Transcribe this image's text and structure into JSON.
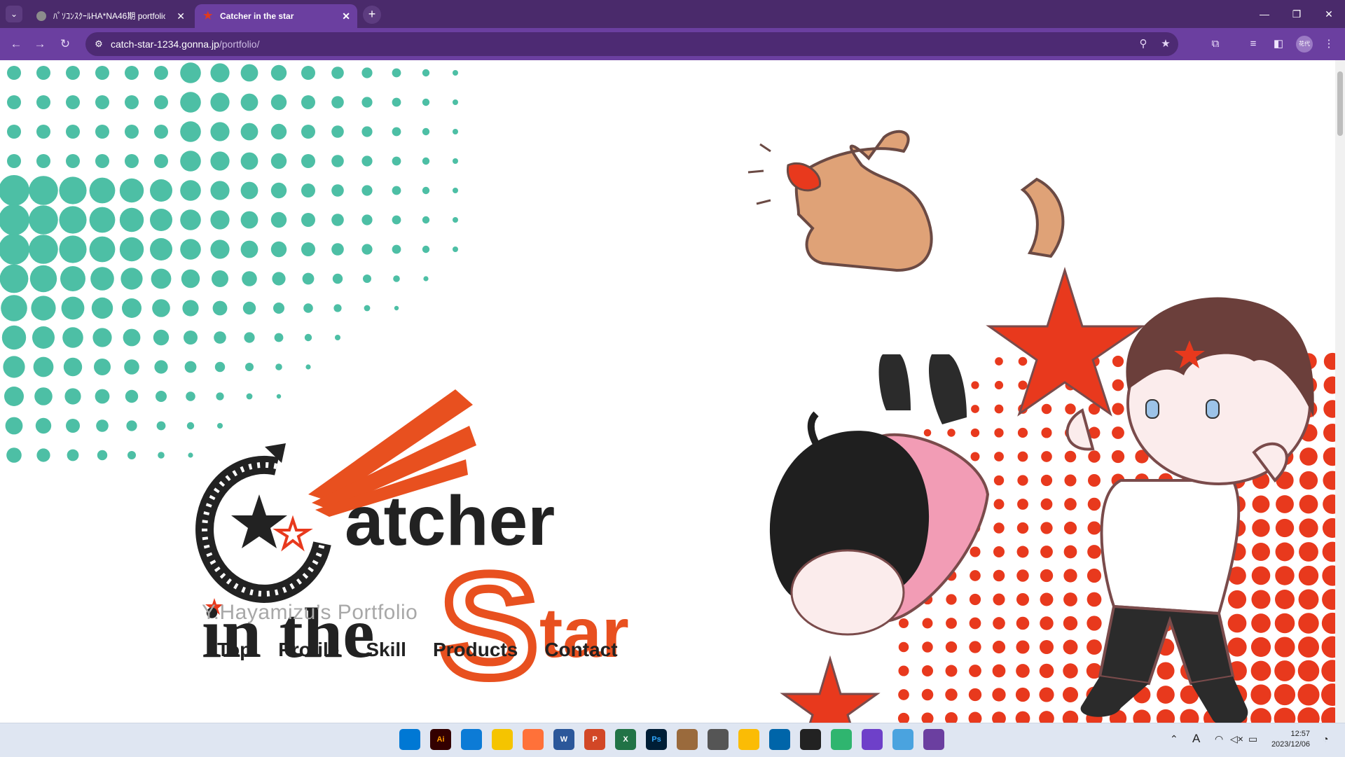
{
  "browser": {
    "tabs": [
      {
        "title": "ﾊﾟｿｺﾝｽｸｰﾙHA*NA46期 portfolio",
        "active": false
      },
      {
        "title": "Catcher in the star",
        "active": true
      }
    ],
    "tab_menu_icon": "chevron-down-icon",
    "new_tab_icon": "plus-icon",
    "address": {
      "host": "catch-star-1234.gonna.jp",
      "path": "/portfolio/"
    },
    "profile_label": "花代",
    "window_controls": [
      "minimize-icon",
      "restore-icon",
      "close-icon"
    ],
    "colors": {
      "frame": "#4a2a6b",
      "toolbar": "#6b3fa0",
      "omnibox": "#4d2a73"
    }
  },
  "page": {
    "logo": {
      "line1": "atcher",
      "line2": "in the",
      "line3_big": "S",
      "line3_rest": "tar",
      "subtitle": "Y.Hayamizu’s Portfolio"
    },
    "nav": [
      {
        "label": "Top"
      },
      {
        "label": "Profile"
      },
      {
        "label": "Skill"
      },
      {
        "label": "Products"
      },
      {
        "label": "Contact"
      }
    ],
    "colors": {
      "teal": "#4dbfa5",
      "red": "#e8391d",
      "dark": "#222222",
      "grey": "#a8a8a8"
    }
  },
  "taskbar": {
    "apps": [
      {
        "name": "windows-start-icon",
        "label": ""
      },
      {
        "name": "illustrator-icon",
        "label": "Ai"
      },
      {
        "name": "edge-icon",
        "label": ""
      },
      {
        "name": "file-explorer-icon",
        "label": ""
      },
      {
        "name": "firefox-icon",
        "label": ""
      },
      {
        "name": "word-icon",
        "label": "W"
      },
      {
        "name": "powerpoint-icon",
        "label": "P"
      },
      {
        "name": "excel-icon",
        "label": "X"
      },
      {
        "name": "photoshop-icon",
        "label": "Ps"
      },
      {
        "name": "paint-icon",
        "label": ""
      },
      {
        "name": "calculator-icon",
        "label": ""
      },
      {
        "name": "chrome-icon",
        "label": ""
      },
      {
        "name": "vscode-icon",
        "label": ""
      },
      {
        "name": "sticky-notes-icon",
        "label": ""
      },
      {
        "name": "app-diamond-icon",
        "label": ""
      },
      {
        "name": "github-icon",
        "label": ""
      },
      {
        "name": "maps-icon",
        "label": ""
      },
      {
        "name": "chrome-profile-icon",
        "label": ""
      }
    ],
    "ime": "A",
    "clock": {
      "time": "12:57",
      "date": "2023/12/06"
    }
  }
}
